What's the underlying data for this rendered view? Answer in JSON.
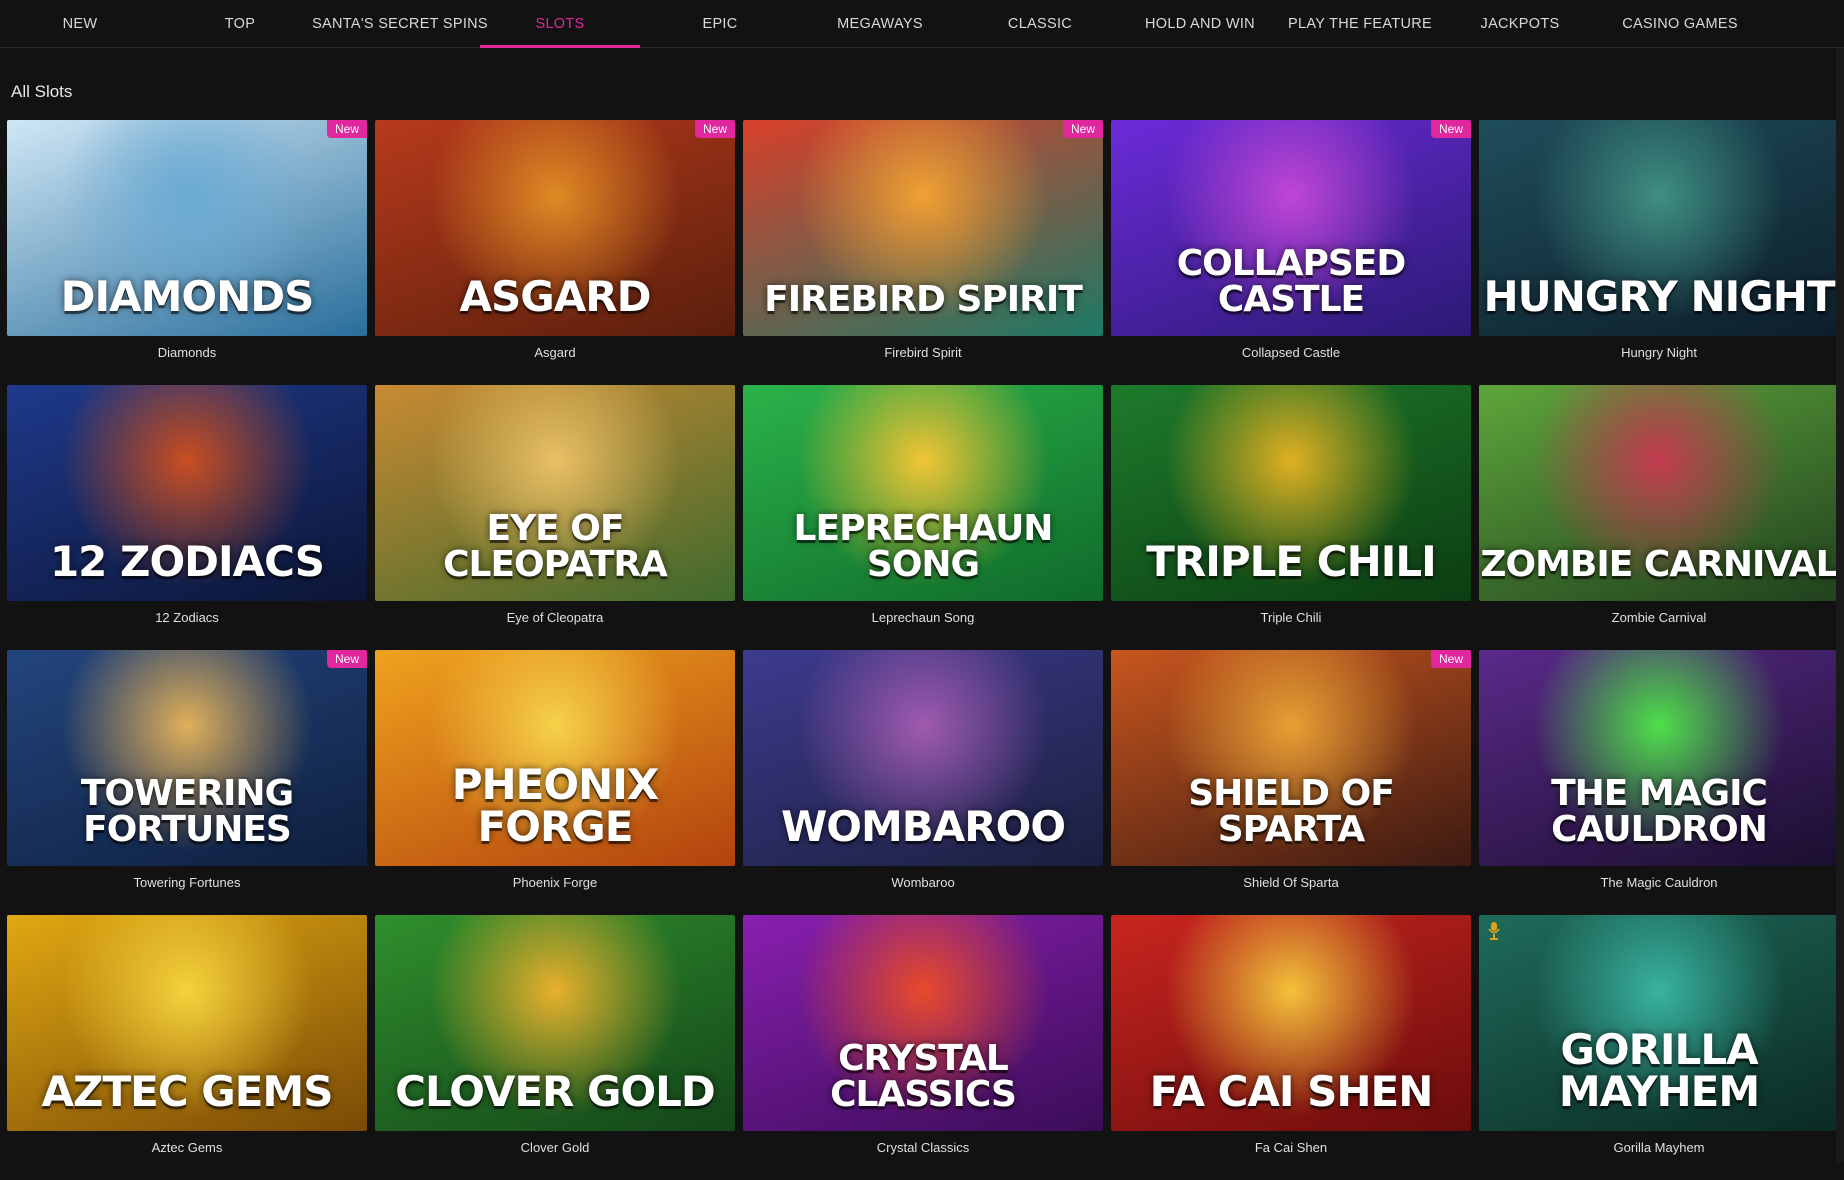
{
  "nav": {
    "tabs": [
      {
        "label": "NEW",
        "active": false
      },
      {
        "label": "TOP",
        "active": false
      },
      {
        "label": "SANTA'S SECRET SPINS",
        "active": false
      },
      {
        "label": "SLOTS",
        "active": true
      },
      {
        "label": "EPIC",
        "active": false
      },
      {
        "label": "MEGAWAYS",
        "active": false
      },
      {
        "label": "CLASSIC",
        "active": false
      },
      {
        "label": "HOLD AND WIN",
        "active": false
      },
      {
        "label": "PLAY THE FEATURE",
        "active": false
      },
      {
        "label": "JACKPOTS",
        "active": false
      },
      {
        "label": "CASINO GAMES",
        "active": false
      }
    ],
    "accent_color": "#e2269e"
  },
  "section": {
    "title": "All Slots"
  },
  "badge_label": "New",
  "games": [
    {
      "title": "Diamonds",
      "art_title": "DIAMONDS",
      "badge": true,
      "colors": [
        "#cfe7f5",
        "#6aaad3",
        "#2a6e9c"
      ]
    },
    {
      "title": "Asgard",
      "art_title": "ASGARD",
      "badge": true,
      "colors": [
        "#b73a1c",
        "#e08a24",
        "#5a1f0c"
      ]
    },
    {
      "title": "Firebird Spirit",
      "art_title": "FIREBIRD SPIRIT",
      "badge": true,
      "colors": [
        "#d8402a",
        "#f0a033",
        "#1d7a66"
      ]
    },
    {
      "title": "Collapsed Castle",
      "art_title": "COLLAPSED CASTLE",
      "badge": true,
      "colors": [
        "#6c2bd9",
        "#c046d6",
        "#2b1a74"
      ]
    },
    {
      "title": "Hungry Night",
      "art_title": "HUNGRY NIGHT",
      "badge": false,
      "colors": [
        "#1f4d5a",
        "#3f8f82",
        "#0d1e2b"
      ]
    },
    {
      "title": "12 Zodiacs",
      "art_title": "12 ZODIACS",
      "badge": false,
      "colors": [
        "#1f3a8c",
        "#c94e20",
        "#0c1535"
      ]
    },
    {
      "title": "Eye of Cleopatra",
      "art_title": "EYE OF CLEOPATRA",
      "badge": false,
      "colors": [
        "#c98a32",
        "#e9c065",
        "#3f6a2d"
      ]
    },
    {
      "title": "Leprechaun Song",
      "art_title": "LEPRECHAUN SONG",
      "badge": false,
      "colors": [
        "#2bb34a",
        "#f2c534",
        "#0f6a2a"
      ]
    },
    {
      "title": "Triple Chili",
      "art_title": "TRIPLE CHILI",
      "badge": false,
      "colors": [
        "#1e7b2b",
        "#e0b022",
        "#0c3d12"
      ]
    },
    {
      "title": "Zombie Carnival",
      "art_title": "ZOMBIE CARNIVAL",
      "badge": false,
      "colors": [
        "#5ea63b",
        "#c33a4f",
        "#21411e"
      ]
    },
    {
      "title": "Towering Fortunes",
      "art_title": "TOWERING FORTUNES",
      "badge": true,
      "colors": [
        "#23457e",
        "#e0b05a",
        "#0f1f3e"
      ]
    },
    {
      "title": "Phoenix Forge",
      "art_title": "PHEONIX FORGE",
      "badge": false,
      "colors": [
        "#f0a21e",
        "#f6d24a",
        "#b2430e"
      ]
    },
    {
      "title": "Wombaroo",
      "art_title": "WOMBAROO",
      "badge": false,
      "colors": [
        "#3d3b8f",
        "#a05ab0",
        "#1b1f3d"
      ]
    },
    {
      "title": "Shield Of Sparta",
      "art_title": "SHIELD OF SPARTA",
      "badge": true,
      "colors": [
        "#c8561e",
        "#e8a034",
        "#3c1a12"
      ]
    },
    {
      "title": "The Magic Cauldron",
      "art_title": "THE MAGIC CAULDRON",
      "badge": false,
      "colors": [
        "#5a2a8a",
        "#4fe04a",
        "#1a0f2e"
      ]
    },
    {
      "title": "Aztec Gems",
      "art_title": "AZTEC GEMS",
      "badge": false,
      "colors": [
        "#e0a812",
        "#f5d23c",
        "#7a4a06"
      ]
    },
    {
      "title": "Clover Gold",
      "art_title": "CLOVER GOLD",
      "badge": false,
      "colors": [
        "#2f8f2c",
        "#e8b02c",
        "#14461a"
      ]
    },
    {
      "title": "Crystal Classics",
      "art_title": "CRYSTAL CLASSICS",
      "badge": false,
      "colors": [
        "#8a1fb0",
        "#e84a2a",
        "#3a0d58"
      ]
    },
    {
      "title": "Fa Cai Shen",
      "art_title": "FA CAI SHEN",
      "badge": false,
      "colors": [
        "#c9251f",
        "#f3c23a",
        "#6a0c0c"
      ]
    },
    {
      "title": "Gorilla Mayhem",
      "art_title": "GORILLA MAYHEM",
      "badge": false,
      "mic": true,
      "colors": [
        "#1f6b5a",
        "#38b3a0",
        "#0b2a24"
      ]
    }
  ]
}
